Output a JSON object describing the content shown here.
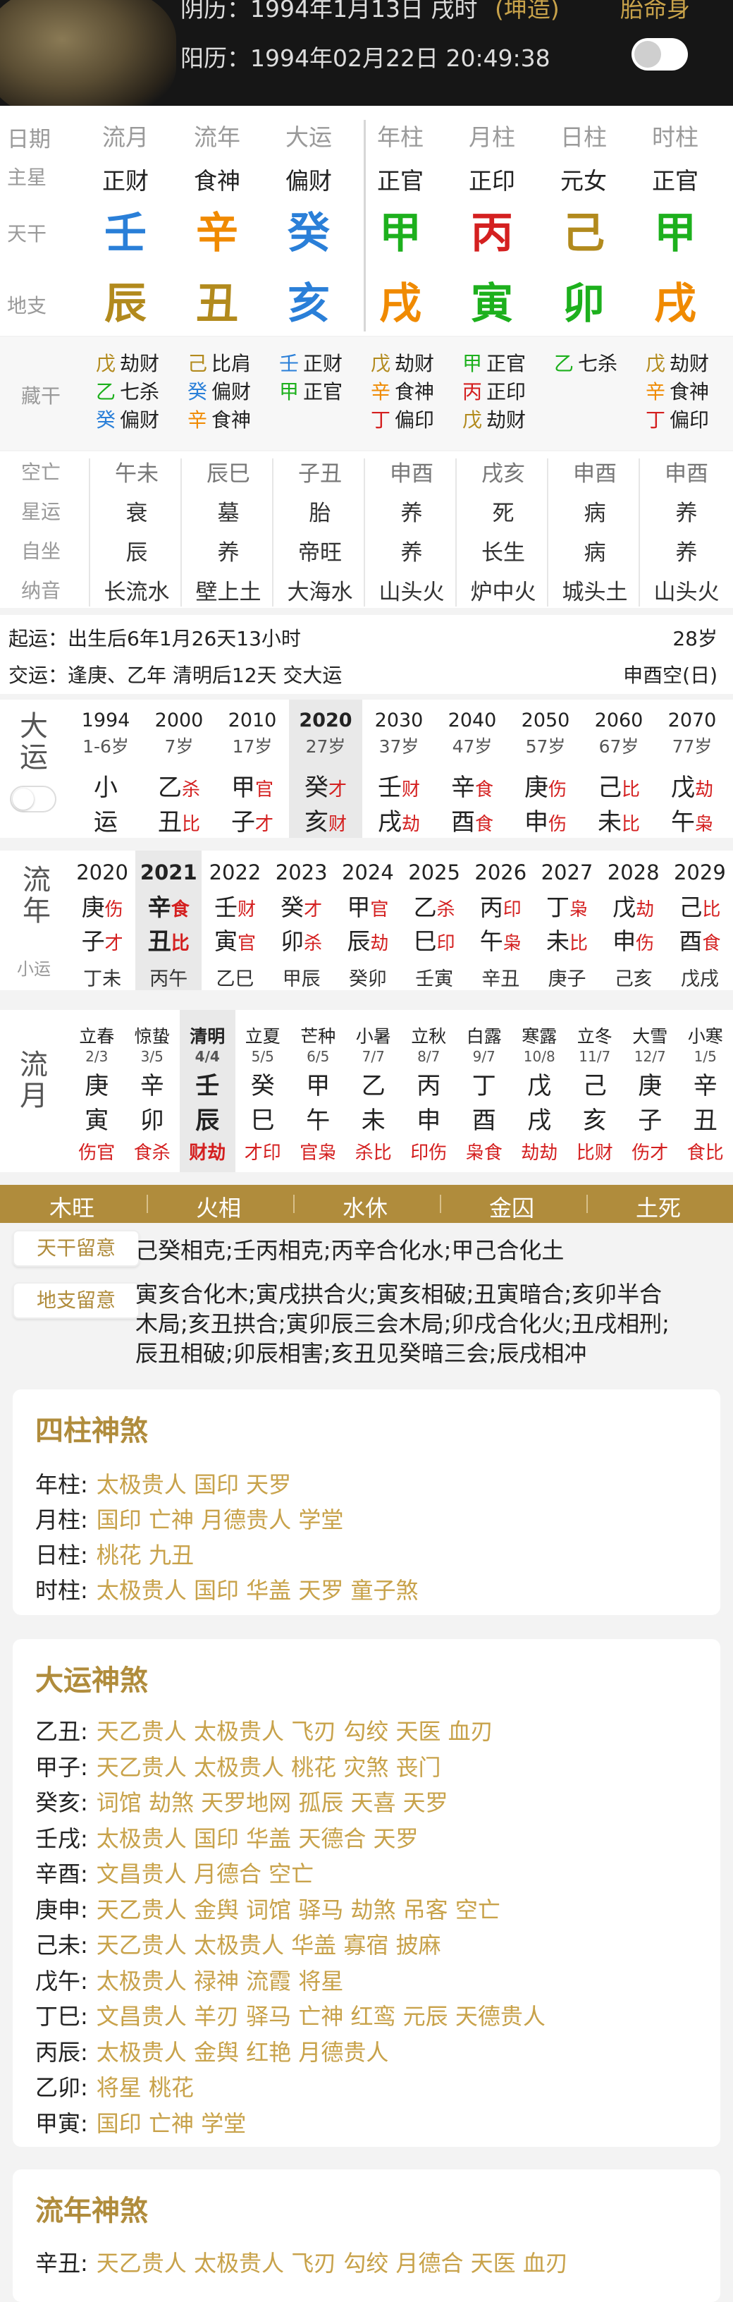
{
  "header": {
    "lunar": "阴历：1994年1月13日 戌时",
    "lunar_tag": "(坤造)",
    "right_tag": "胎命身",
    "solar": "阳历：1994年02月22日 20:49:38"
  },
  "pillars": {
    "row_labels": {
      "date": "日期",
      "zhuxing": "主星",
      "tiangan": "天干",
      "dizhi": "地支"
    },
    "cols": [
      {
        "h": "流月",
        "zx": "正财",
        "tg": "壬",
        "dz": "辰"
      },
      {
        "h": "流年",
        "zx": "食神",
        "tg": "辛",
        "dz": "丑"
      },
      {
        "h": "大运",
        "zx": "偏财",
        "tg": "癸",
        "dz": "亥"
      },
      {
        "h": "年柱",
        "zx": "正官",
        "tg": "甲",
        "dz": "戌"
      },
      {
        "h": "月柱",
        "zx": "正印",
        "tg": "丙",
        "dz": "寅"
      },
      {
        "h": "日柱",
        "zx": "元女",
        "tg": "己",
        "dz": "卯"
      },
      {
        "h": "时柱",
        "zx": "正官",
        "tg": "甲",
        "dz": "戌"
      }
    ]
  },
  "canggan": {
    "label": "藏干",
    "cols": [
      [
        [
          "戊",
          "劫财"
        ],
        [
          "乙",
          "七杀"
        ],
        [
          "癸",
          "偏财"
        ]
      ],
      [
        [
          "己",
          "比肩"
        ],
        [
          "癸",
          "偏财"
        ],
        [
          "辛",
          "食神"
        ]
      ],
      [
        [
          "壬",
          "正财"
        ],
        [
          "甲",
          "正官"
        ]
      ],
      [
        [
          "戊",
          "劫财"
        ],
        [
          "辛",
          "食神"
        ],
        [
          "丁",
          "偏印"
        ]
      ],
      [
        [
          "甲",
          "正官"
        ],
        [
          "丙",
          "正印"
        ],
        [
          "戊",
          "劫财"
        ]
      ],
      [
        [
          "乙",
          "七杀"
        ]
      ],
      [
        [
          "戊",
          "劫财"
        ],
        [
          "辛",
          "食神"
        ],
        [
          "丁",
          "偏印"
        ]
      ]
    ]
  },
  "misc": {
    "labels": [
      "空亡",
      "星运",
      "自坐",
      "纳音"
    ],
    "cols": [
      [
        "午未",
        "衰",
        "辰",
        "长流水"
      ],
      [
        "辰巳",
        "墓",
        "养",
        "壁上土"
      ],
      [
        "子丑",
        "胎",
        "帝旺",
        "大海水"
      ],
      [
        "申酉",
        "养",
        "养",
        "山头火"
      ],
      [
        "戌亥",
        "死",
        "长生",
        "炉中火"
      ],
      [
        "申酉",
        "病",
        "病",
        "城头土"
      ],
      [
        "申酉",
        "养",
        "养",
        "山头火"
      ]
    ]
  },
  "qiyun": {
    "line1": "起运：出生后6年1月26天13小时",
    "age": "28岁",
    "line2": "交运：逢庚、乙年 清明后12天 交大运",
    "kong": "申酉空(日)"
  },
  "dayun": {
    "label": "大运",
    "cols": [
      {
        "y": "1994",
        "a": "1-6岁",
        "g": "小",
        "gs": "",
        "z": "运",
        "zs": ""
      },
      {
        "y": "2000",
        "a": "7岁",
        "g": "乙",
        "gs": "杀",
        "z": "丑",
        "zs": "比"
      },
      {
        "y": "2010",
        "a": "17岁",
        "g": "甲",
        "gs": "官",
        "z": "子",
        "zs": "才"
      },
      {
        "y": "2020",
        "a": "27岁",
        "g": "癸",
        "gs": "才",
        "z": "亥",
        "zs": "财"
      },
      {
        "y": "2030",
        "a": "37岁",
        "g": "壬",
        "gs": "财",
        "z": "戌",
        "zs": "劫"
      },
      {
        "y": "2040",
        "a": "47岁",
        "g": "辛",
        "gs": "食",
        "z": "酉",
        "zs": "食"
      },
      {
        "y": "2050",
        "a": "57岁",
        "g": "庚",
        "gs": "伤",
        "z": "申",
        "zs": "伤"
      },
      {
        "y": "2060",
        "a": "67岁",
        "g": "己",
        "gs": "比",
        "z": "未",
        "zs": "比"
      },
      {
        "y": "2070",
        "a": "77岁",
        "g": "戊",
        "gs": "劫",
        "z": "午",
        "zs": "枭"
      }
    ]
  },
  "liunian": {
    "label": "流年",
    "sub": "小运",
    "cols": [
      {
        "y": "2020",
        "g": "庚",
        "gs": "伤",
        "z": "子",
        "zs": "才",
        "x": "丁未"
      },
      {
        "y": "2021",
        "g": "辛",
        "gs": "食",
        "z": "丑",
        "zs": "比",
        "x": "丙午"
      },
      {
        "y": "2022",
        "g": "壬",
        "gs": "财",
        "z": "寅",
        "zs": "官",
        "x": "乙巳"
      },
      {
        "y": "2023",
        "g": "癸",
        "gs": "才",
        "z": "卯",
        "zs": "杀",
        "x": "甲辰"
      },
      {
        "y": "2024",
        "g": "甲",
        "gs": "官",
        "z": "辰",
        "zs": "劫",
        "x": "癸卯"
      },
      {
        "y": "2025",
        "g": "乙",
        "gs": "杀",
        "z": "巳",
        "zs": "印",
        "x": "壬寅"
      },
      {
        "y": "2026",
        "g": "丙",
        "gs": "印",
        "z": "午",
        "zs": "枭",
        "x": "辛丑"
      },
      {
        "y": "2027",
        "g": "丁",
        "gs": "枭",
        "z": "未",
        "zs": "比",
        "x": "庚子"
      },
      {
        "y": "2028",
        "g": "戊",
        "gs": "劫",
        "z": "申",
        "zs": "伤",
        "x": "己亥"
      },
      {
        "y": "2029",
        "g": "己",
        "gs": "比",
        "z": "酉",
        "zs": "食",
        "x": "戊戌"
      }
    ]
  },
  "liuyue": {
    "label": "流月",
    "cols": [
      {
        "j": "立春",
        "d": "2/3",
        "g": "庚",
        "z": "寅",
        "s": "伤官"
      },
      {
        "j": "惊蛰",
        "d": "3/5",
        "g": "辛",
        "z": "卯",
        "s": "食杀"
      },
      {
        "j": "清明",
        "d": "4/4",
        "g": "壬",
        "z": "辰",
        "s": "财劫"
      },
      {
        "j": "立夏",
        "d": "5/5",
        "g": "癸",
        "z": "巳",
        "s": "才印"
      },
      {
        "j": "芒种",
        "d": "6/5",
        "g": "甲",
        "z": "午",
        "s": "官枭"
      },
      {
        "j": "小暑",
        "d": "7/7",
        "g": "乙",
        "z": "未",
        "s": "杀比"
      },
      {
        "j": "立秋",
        "d": "8/7",
        "g": "丙",
        "z": "申",
        "s": "印伤"
      },
      {
        "j": "白露",
        "d": "9/7",
        "g": "丁",
        "z": "酉",
        "s": "枭食"
      },
      {
        "j": "寒露",
        "d": "10/8",
        "g": "戊",
        "z": "戌",
        "s": "劫劫"
      },
      {
        "j": "立冬",
        "d": "11/7",
        "g": "己",
        "z": "亥",
        "s": "比财"
      },
      {
        "j": "大雪",
        "d": "12/7",
        "g": "庚",
        "z": "子",
        "s": "伤才"
      },
      {
        "j": "小寒",
        "d": "1/5",
        "g": "辛",
        "z": "丑",
        "s": "食比"
      }
    ]
  },
  "wuxing": [
    "木旺",
    "火相",
    "水休",
    "金囚",
    "土死"
  ],
  "liuyi": {
    "tg_btn": "天干留意",
    "tg_text": "己癸相克;壬丙相克;丙辛合化水;甲己合化土",
    "dz_btn": "地支留意",
    "dz_lines": [
      "寅亥合化木;寅戌拱合火;寅亥相破;丑寅暗合;亥卯半合",
      "木局;亥丑拱合;寅卯辰三会木局;卯戌合化火;丑戌相刑;",
      "辰丑相破;卯辰相害;亥丑见癸暗三会;辰戌相冲"
    ]
  },
  "sizhu_shensha": {
    "title": "四柱神煞",
    "rows": [
      {
        "k": "年柱:",
        "v": "太极贵人 国印 天罗"
      },
      {
        "k": "月柱:",
        "v": "国印 亡神 月德贵人 学堂"
      },
      {
        "k": "日柱:",
        "v": "桃花 九丑"
      },
      {
        "k": "时柱:",
        "v": "太极贵人 国印 华盖 天罗 童子煞"
      }
    ]
  },
  "dayun_shensha": {
    "title": "大运神煞",
    "rows": [
      {
        "k": "乙丑:",
        "v": "天乙贵人 太极贵人 飞刃 勾绞 天医 血刃"
      },
      {
        "k": "甲子:",
        "v": "天乙贵人 太极贵人 桃花 灾煞 丧门"
      },
      {
        "k": "癸亥:",
        "v": "词馆 劫煞 天罗地网 孤辰 天喜 天罗"
      },
      {
        "k": "壬戌:",
        "v": "太极贵人 国印 华盖 天德合 天罗"
      },
      {
        "k": "辛酉:",
        "v": "文昌贵人 月德合 空亡"
      },
      {
        "k": "庚申:",
        "v": "天乙贵人 金舆 词馆 驿马 劫煞 吊客 空亡"
      },
      {
        "k": "己未:",
        "v": "天乙贵人 太极贵人 华盖 寡宿 披麻"
      },
      {
        "k": "戊午:",
        "v": "太极贵人 禄神 流霞 将星"
      },
      {
        "k": "丁巳:",
        "v": "文昌贵人 羊刃 驿马 亡神 红鸾 元辰 天德贵人"
      },
      {
        "k": "丙辰:",
        "v": "太极贵人 金舆 红艳 月德贵人"
      },
      {
        "k": "乙卯:",
        "v": "将星 桃花"
      },
      {
        "k": "甲寅:",
        "v": "国印 亡神 学堂"
      }
    ]
  },
  "liunian_shensha": {
    "title": "流年神煞",
    "rows": [
      {
        "k": "辛丑:",
        "v": "天乙贵人 太极贵人 飞刃 勾绞 月德合 天医 血刃"
      }
    ]
  },
  "colors": {
    "gold": "#b08c3c",
    "red": "#d42020",
    "green": "#1db01d",
    "blue": "#2a7fd8",
    "tg_gold": "#b28a1d"
  }
}
